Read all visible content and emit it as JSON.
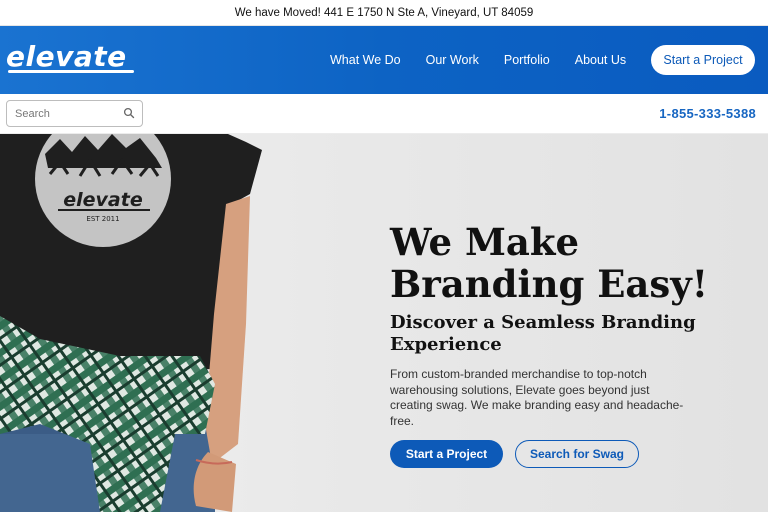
{
  "announcement": "We have Moved! 441 E 1750 N Ste A, Vineyard, UT 84059",
  "brand": {
    "logo_text": "elevate",
    "shirt_logo_text": "elevate",
    "shirt_logo_sub": "EST 2011",
    "primary_color": "#0d5ab8"
  },
  "nav": {
    "items": [
      {
        "label": "What We Do"
      },
      {
        "label": "Our Work"
      },
      {
        "label": "Portfolio"
      },
      {
        "label": "About Us"
      }
    ],
    "cta_label": "Start a Project"
  },
  "search": {
    "placeholder": "Search",
    "value": "",
    "icon": "search-icon"
  },
  "phone": "1-855-333-5388",
  "hero": {
    "title_line1": "We Make",
    "title_line2": "Branding Easy!",
    "subtitle": "Discover a Seamless Branding Experience",
    "body": "From custom-branded merchandise to top-notch warehousing solutions, Elevate goes beyond just creating swag. We make branding easy and headache-free.",
    "primary_button": "Start a Project",
    "secondary_button": "Search for Swag"
  }
}
